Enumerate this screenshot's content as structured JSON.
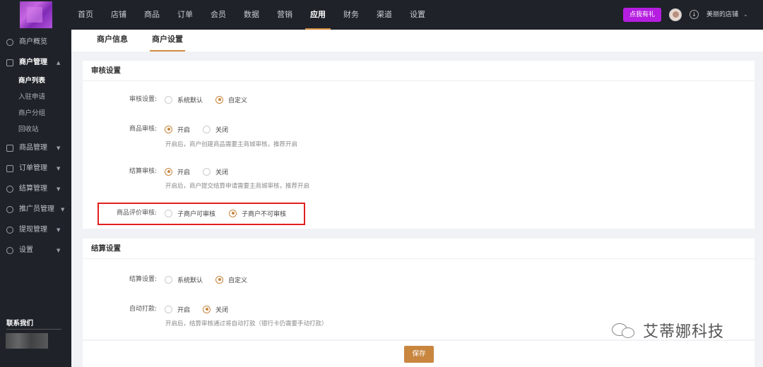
{
  "topnav": {
    "items": [
      "首页",
      "店铺",
      "商品",
      "订单",
      "会员",
      "数据",
      "营销",
      "应用",
      "财务",
      "渠道",
      "设置"
    ],
    "active_index": 7,
    "gift_button": "点我有礼",
    "shop_name": "美丽的店铺",
    "caret": "⌄",
    "download_glyph": "↓"
  },
  "sidebar": {
    "groups": [
      {
        "label": "商户概览",
        "icon": "gear-icon",
        "caret": ""
      },
      {
        "label": "商户管理",
        "icon": "store-icon",
        "caret": "▲"
      },
      {
        "label": "商品管理",
        "icon": "goods-icon",
        "caret": "▼"
      },
      {
        "label": "订单管理",
        "icon": "order-icon",
        "caret": "▼"
      },
      {
        "label": "结算管理",
        "icon": "settle-icon",
        "caret": "▼"
      },
      {
        "label": "推广员管理",
        "icon": "promoter-icon",
        "caret": "▼"
      },
      {
        "label": "提现管理",
        "icon": "withdraw-icon",
        "caret": "▼"
      },
      {
        "label": "设置",
        "icon": "settings-icon",
        "caret": "▼"
      }
    ],
    "sub_items": [
      "商户列表",
      "入驻申请",
      "商户分组",
      "回收站"
    ],
    "active_sub": 0,
    "contact": "联系我们"
  },
  "tabs": [
    "商户信息",
    "商户设置"
  ],
  "active_tab": 1,
  "audit": {
    "title": "审核设置",
    "rows": [
      {
        "label": "审核设置:",
        "options": [
          "系统默认",
          "自定义"
        ],
        "selected": 1,
        "hint": ""
      },
      {
        "label": "商品审核:",
        "options": [
          "开启",
          "关闭"
        ],
        "selected": 0,
        "hint": "开启后，商户创建商品需要主商城审核，推荐开启"
      },
      {
        "label": "结算审核:",
        "options": [
          "开启",
          "关闭"
        ],
        "selected": 0,
        "hint": "开启后，商户提交结算申请需要主商城审核，推荐开启"
      },
      {
        "label": "商品评价审核:",
        "options": [
          "子商户可审核",
          "子商户不可审核"
        ],
        "selected": 1,
        "hint": ""
      }
    ]
  },
  "settlement": {
    "title": "结算设置",
    "rows": [
      {
        "label": "结算设置:",
        "options": [
          "系统默认",
          "自定义"
        ],
        "selected": 1,
        "hint": ""
      },
      {
        "label": "自动打款:",
        "options": [
          "开启",
          "关闭"
        ],
        "selected": 1,
        "hint": "开启后，结算审核通过将自动打款（银行卡仍需要手动打款）"
      }
    ]
  },
  "save_label": "保存",
  "watermark": "艾蒂娜科技",
  "colors": {
    "accent": "#c8863f",
    "nav_bg": "#1f2329",
    "gift": "#b51ee0",
    "highlight": "#e02020"
  }
}
